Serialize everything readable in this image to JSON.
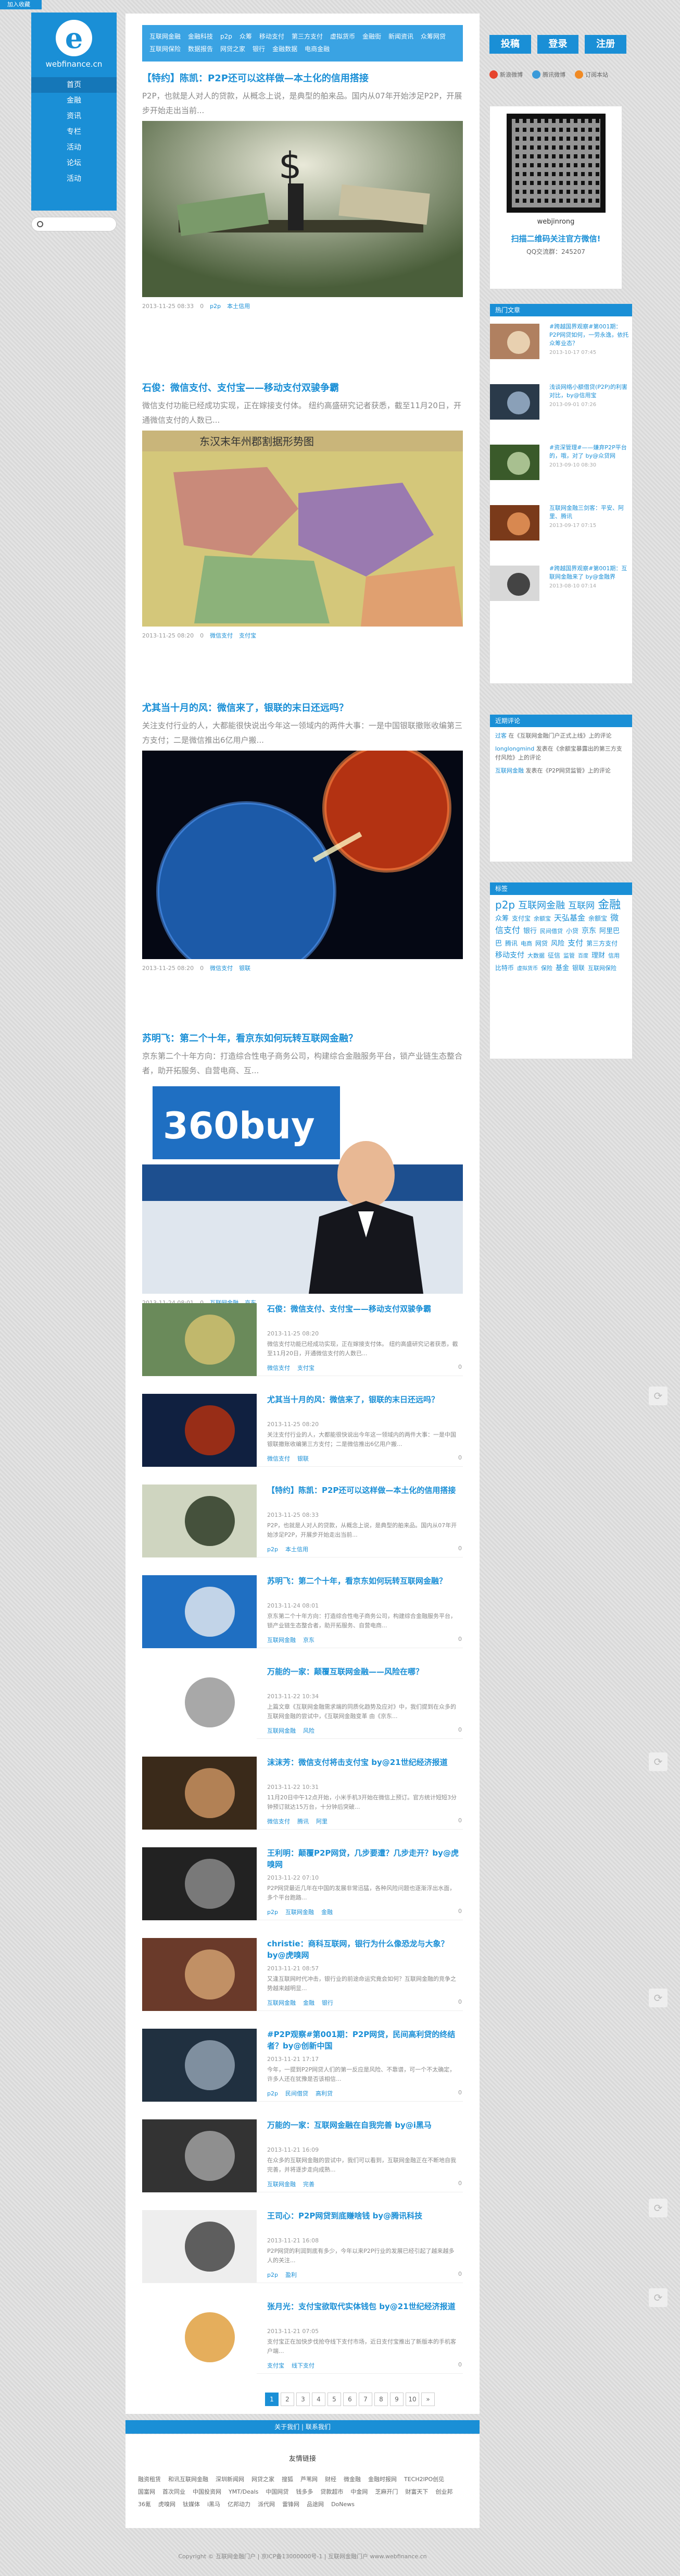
{
  "ribbon": "加入收藏",
  "logo": {
    "letter": "e",
    "text": "webfinance.cn"
  },
  "left_nav": [
    "首页",
    "金融",
    "资讯",
    "专栏",
    "活动",
    "论坛",
    "活动"
  ],
  "search_placeholder": "",
  "side_dots": [
    "",
    "",
    "",
    "",
    "",
    ""
  ],
  "main_nav": [
    "互联网金融",
    "金融科技",
    "p2p",
    "众筹",
    "移动支付",
    "第三方支付",
    "虚拟货币",
    "金融街",
    "新闻资讯",
    "众筹网贷",
    "互联网保险",
    "数据报告",
    "网贷之家",
    "银行",
    "金融数据",
    "电商金融"
  ],
  "posts": [
    {
      "title": "【特约】陈凯：P2P还可以这样做—本土化的信用搭接",
      "excerpt": "P2P，也就是人对人的贷款，从概念上说，是典型的舶来品。国内从07年开始涉足P2P，开展步开始走出当前...",
      "date": "2013-11-25 08:33",
      "views": "0",
      "tags": [
        "p2p",
        "本土信用"
      ]
    },
    {
      "title": "石俊：微信支付、支付宝——移动支付双骏争霸",
      "excerpt": "微信支付功能已经成功实现，正在嫁接支付体。  纽约高盛研究记者获悉，截至11月20日，开通微信支付的人数已...",
      "date": "2013-11-25 08:20",
      "views": "0",
      "tags": [
        "微信支付",
        "支付宝"
      ]
    },
    {
      "title": "尤其当十月的风：微信来了，银联的末日还远吗？",
      "excerpt": "关注支付行业的人，大都能很快说出今年这一领域内的两件大事：一是中国银联撤账收编第三方支付；二是微信推出6亿用户搬...",
      "date": "2013-11-25 08:20",
      "views": "0",
      "tags": [
        "微信支付",
        "银联"
      ]
    },
    {
      "title": "苏明飞：第二个十年，看京东如何玩转互联网金融？",
      "excerpt": "京东第二个十年方向：打造综合性电子商务公司，构建综合金融服务平台，锁产业链生态整合者，助开拓服务、自营电商、互...",
      "date": "2013-11-24 08:01",
      "views": "0",
      "tags": [
        "互联网金融",
        "京东"
      ]
    }
  ],
  "list_posts": [
    {
      "title": "石俊：微信支付、支付宝——移动支付双骏争霸",
      "date": "2013-11-25 08:20",
      "excerpt": "微信支付功能已经成功实现，正在嫁接支付体。  纽约高盛研究记者获悉，截至11月20日，开通微信支付的人数已...",
      "tags": [
        "微信支付",
        "支付宝"
      ],
      "comments": "0"
    },
    {
      "title": "尤其当十月的风：微信来了，银联的末日还远吗？",
      "date": "2013-11-25 08:20",
      "excerpt": "关注支付行业的人，大都能很快说出今年这一领域内的两件大事：一是中国银联撤账收编第三方支付；二是微信推出6亿用户搬...",
      "tags": [
        "微信支付",
        "银联"
      ],
      "comments": "0"
    },
    {
      "title": "【特约】陈凯：P2P还可以这样做—本土化的信用搭接",
      "date": "2013-11-25 08:33",
      "excerpt": "P2P，也就是人对人的贷款，从概念上说，是典型的舶来品。国内从07年开始涉足P2P，开展步开始走出当前...",
      "tags": [
        "p2p",
        "本土信用"
      ],
      "comments": "0"
    },
    {
      "title": "苏明飞：第二个十年，看京东如何玩转互联网金融？",
      "date": "2013-11-24 08:01",
      "excerpt": "京东第二个十年方向：打造综合性电子商务公司，构建综合金融服务平台，锁产业链生态整合者，助开拓服务、自营电商...",
      "tags": [
        "互联网金融",
        "京东"
      ],
      "comments": "0"
    },
    {
      "title": "万能的一家：颠覆互联网金融——风险在哪？",
      "date": "2013-11-22 10:34",
      "excerpt": "上篇文章《互联网金融需求端的同质化趋势及应对》中，我们提到在众多的互联网金融的尝试中，《互联网金融变革 由《京东...",
      "tags": [
        "互联网金融",
        "风险"
      ],
      "comments": "0"
    },
    {
      "title": "沫沫芳：微信支付将击支付宝 by@21世纪经济报道",
      "date": "2013-11-22 10:31",
      "excerpt": "11月20日中午12点开始，小米手机3开始在微信上预订。官方统计短短3分钟预订就达15万台，十分钟后突破...",
      "tags": [
        "微信支付",
        "腾讯",
        "阿里"
      ],
      "comments": "0"
    },
    {
      "title": "王利明：颠覆P2P网贷，几步要遭？几步走开？by@虎嗅网",
      "date": "2013-11-22 07:10",
      "excerpt": "P2P网贷最近几年在中国的发展非常迅猛，各种风险问题也逐渐浮出水面，多个平台跑路...",
      "tags": [
        "p2p",
        "互联网金融",
        "金融"
      ],
      "comments": "0"
    },
    {
      "title": "christie：商科互联网，银行为什么像恐龙与大象？by@虎嗅网",
      "date": "2013-11-21 08:57",
      "excerpt": "又逢互联网时代冲击，银行业的前途命运究竟会如何？互联网金融的竞争之势越来越明显...",
      "tags": [
        "互联网金融",
        "金融",
        "银行"
      ],
      "comments": "0"
    },
    {
      "title": "#P2P观察#第001期：P2P网贷，民间高利贷的终结者？by@创新中国",
      "date": "2013-11-21 17:17",
      "excerpt": "今年，一提到P2P网贷人们的第一反应是风险、不靠谱，可一个不太确定，许多人还在犹豫是否该相信...",
      "tags": [
        "p2p",
        "民间借贷",
        "高利贷"
      ],
      "comments": "0"
    },
    {
      "title": "万能的一家：互联网金融在自我完善 by@i黑马",
      "date": "2013-11-21 16:09",
      "excerpt": "在众多的互联网金融的尝试中，我们可以看到，互联网金融正在不断地自我完善，并将逐步走向成熟...",
      "tags": [
        "互联网金融",
        "完善"
      ],
      "comments": "0"
    },
    {
      "title": "王司心：P2P网贷到底赚啥钱 by@腾讯科技",
      "date": "2013-11-21 16:08",
      "excerpt": "P2P网贷的利润到底有多少，今年以来P2P行业的发展已经引起了越来越多人的关注...",
      "tags": [
        "p2p",
        "盈利"
      ],
      "comments": "0"
    },
    {
      "title": "张月光：支付宝欲取代实体钱包 by@21世纪经济报道",
      "date": "2013-11-21 07:05",
      "excerpt": "支付宝正在加快步伐抢夺线下支付市场，近日支付宝推出了新版本的手机客户端...",
      "tags": [
        "支付宝",
        "线下支付"
      ],
      "comments": "0"
    }
  ],
  "pager": [
    "1",
    "2",
    "3",
    "4",
    "5",
    "6",
    "7",
    "8",
    "9",
    "10",
    "»"
  ],
  "footer_bar": "关于我们 | 联系我们",
  "links": {
    "title": "友情链接",
    "items": [
      "融资租赁",
      "和讯互联网金融",
      "深圳新闻网",
      "网贷之家",
      "搜狐",
      "芦苇网",
      "财经",
      "微金融",
      "金融时报网",
      "TECH2IPO创见",
      "国富网",
      "首次同业",
      "中国投资网",
      "YMT/Deals",
      "中国网贷",
      "钱多多",
      "贷款超市",
      "中金网",
      "芝麻开门",
      "财富天下",
      "创业邦",
      "36氪",
      "虎嗅网",
      "钛媒体",
      "i黑马",
      "亿邦动力",
      "派代网",
      "雷锋网",
      "品途网",
      "DoNews"
    ]
  },
  "copyright": "Copyright © 互联网金融门户 | 京ICP备13000000号-1 | 互联网金融门户 www.webfinance.cn",
  "right": {
    "buttons": [
      "投稿",
      "登录",
      "注册"
    ],
    "social": [
      "新浪微博",
      "腾讯微博",
      "订阅本站"
    ],
    "qr": {
      "user": "webjinrong",
      "line1": "扫描二维码关注官方微信!",
      "line2": "QQ交流群：245207"
    },
    "hot_title": "热门文章",
    "hot": [
      {
        "title": "#跨越国界观察#第001期：P2P网贷如何，一劳永逸，依托众筹业态？",
        "date": "2013-10-17 07:45"
      },
      {
        "title": "浅谈网络小额借贷(P2P)的利害对比，by@信用宝",
        "date": "2013-09-01 07:26"
      },
      {
        "title": "#资深管理#——嫌弃P2P平台的，哦，对了 by@众贷网",
        "date": "2013-09-10 08:30"
      },
      {
        "title": "互联网金融三剑客：平安、阿里、腾讯",
        "date": "2013-09-17 07:15"
      },
      {
        "title": "#跨越国界观察#第001期：互联网金融来了 by@金融界",
        "date": "2013-08-10 07:14"
      }
    ],
    "comments_title": "近期评论",
    "comments": [
      {
        "who": "过客",
        "text": "在《互联网金融门户正式上线》上的评论"
      },
      {
        "who": "longlongmind",
        "text": "发表在《余额宝暴露出的第三方支付风险》上的评论"
      },
      {
        "who": "互联网金融",
        "text": "发表在《P2P网贷监管》上的评论"
      }
    ],
    "tags_title": "标签",
    "tags": [
      "p2p",
      "互联网金融",
      "互联网",
      "金融",
      "众筹",
      "支付宝",
      "余额宝",
      "天弘基金",
      "余额宝",
      "微信支付",
      "银行",
      "民间借贷",
      "小贷",
      "京东",
      "阿里巴巴",
      "腾讯",
      "电商",
      "网贷",
      "风险",
      "支付",
      "第三方支付",
      "移动支付",
      "大数据",
      "征信",
      "监管",
      "百度",
      "理财",
      "信用",
      "比特币",
      "虚拟货币",
      "保险",
      "基金",
      "银联",
      "互联网保险"
    ]
  }
}
